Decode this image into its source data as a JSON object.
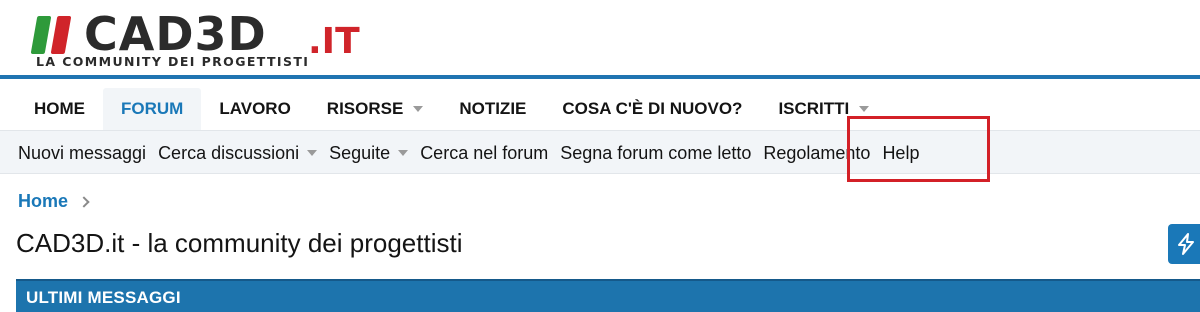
{
  "logo": {
    "name": "CAD3D",
    "suffix": ".IT",
    "tagline": "LA COMMUNITY DEI PROGETTISTI"
  },
  "colors": {
    "accent": "#1a78b8",
    "logo_green": "#2e9a3a",
    "logo_red": "#d0242a",
    "highlight_box": "#d32027"
  },
  "nav": {
    "items": [
      {
        "label": "HOME"
      },
      {
        "label": "FORUM",
        "active": true
      },
      {
        "label": "LAVORO"
      },
      {
        "label": "RISORSE",
        "dropdown": true
      },
      {
        "label": "NOTIZIE"
      },
      {
        "label": "COSA C'È DI NUOVO?"
      },
      {
        "label": "ISCRITTI",
        "dropdown": true
      }
    ]
  },
  "subnav": {
    "items": [
      {
        "label": "Nuovi messaggi"
      },
      {
        "label": "Cerca discussioni",
        "dropdown": true
      },
      {
        "label": "Seguite",
        "dropdown": true
      },
      {
        "label": "Cerca nel forum"
      },
      {
        "label": "Segna forum come letto"
      },
      {
        "label": "Regolamento",
        "highlighted": true
      },
      {
        "label": "Help"
      }
    ]
  },
  "breadcrumb": {
    "home": "Home"
  },
  "page": {
    "title": "CAD3D.it - la community dei progettisti"
  },
  "block": {
    "header": "ULTIMI MESSAGGI"
  },
  "icons": {
    "action_button": "lightning-bolt-icon"
  }
}
